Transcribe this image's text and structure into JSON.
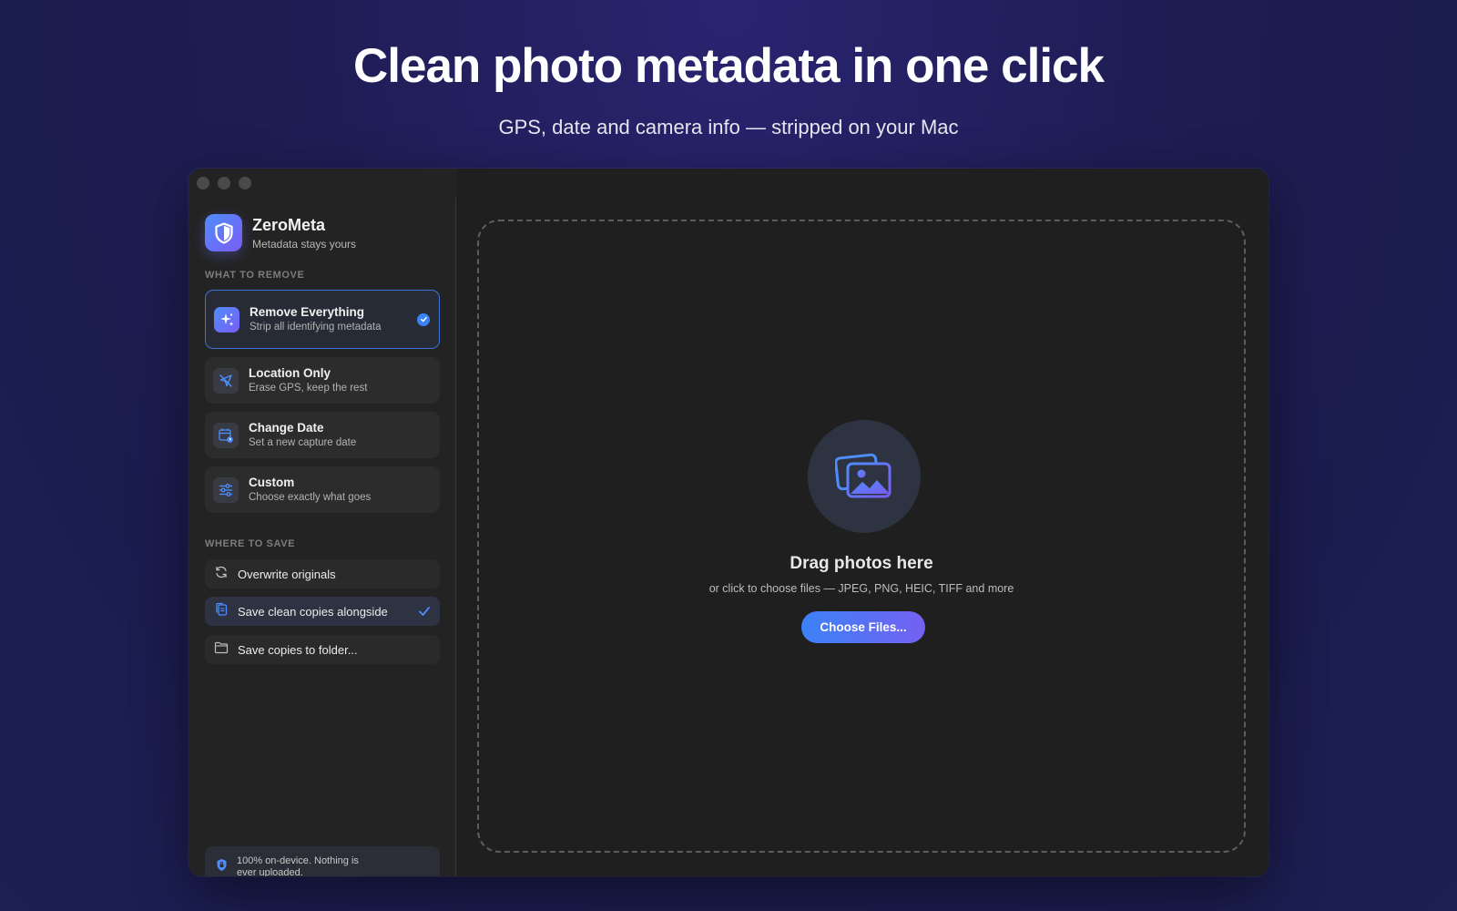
{
  "hero": {
    "title": "Clean photo metadata in one click",
    "subtitle": "GPS, date and camera info — stripped on your Mac"
  },
  "app": {
    "name": "ZeroMeta",
    "tagline": "Metadata stays yours"
  },
  "sidebar": {
    "remove_section_label": "WHAT TO REMOVE",
    "remove_options": [
      {
        "title": "Remove Everything",
        "desc": "Strip all identifying metadata",
        "icon": "sparkles-icon",
        "selected": true
      },
      {
        "title": "Location Only",
        "desc": "Erase GPS, keep the rest",
        "icon": "location-off-icon",
        "selected": false
      },
      {
        "title": "Change Date",
        "desc": "Set a new capture date",
        "icon": "calendar-clock-icon",
        "selected": false
      },
      {
        "title": "Custom",
        "desc": "Choose exactly what goes",
        "icon": "sliders-icon",
        "selected": false
      }
    ],
    "save_section_label": "WHERE TO SAVE",
    "save_options": [
      {
        "label": "Overwrite originals",
        "icon": "refresh-icon",
        "selected": false
      },
      {
        "label": "Save clean copies alongside",
        "icon": "copy-doc-icon",
        "selected": true
      },
      {
        "label": "Save copies to folder...",
        "icon": "folder-icon",
        "selected": false
      }
    ],
    "footer_note": "100% on-device. Nothing is ever uploaded."
  },
  "dropzone": {
    "title": "Drag photos here",
    "subtitle": "or click to choose files — JPEG, PNG, HEIC, TIFF and more",
    "button_label": "Choose Files..."
  },
  "colors": {
    "accent": "#3b82f6",
    "accent_purple": "#7a5cf4",
    "window_bg": "#232323"
  }
}
